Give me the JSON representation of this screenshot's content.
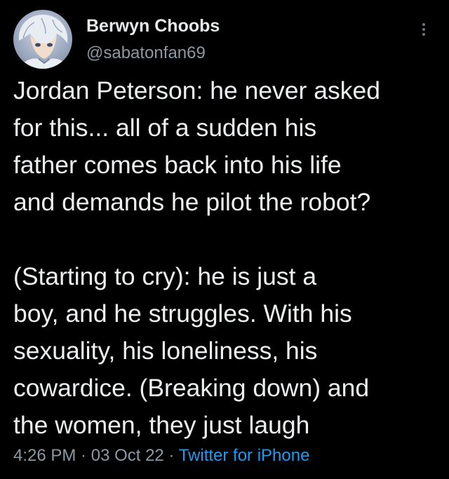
{
  "colors": {
    "background": "#000000",
    "primary_text": "#e7e9ea",
    "secondary_text": "#8b98a5",
    "link": "#1d9bf0"
  },
  "author": {
    "display_name": "Berwyn Choobs",
    "handle": "@sabatonfan69",
    "avatar_icon": "anime-character-avatar"
  },
  "menu": {
    "icon": "more-vertical-icon"
  },
  "tweet": {
    "lines": [
      "Jordan Peterson: he never asked",
      "for this... all of a sudden his",
      "father comes back into his life",
      "and demands he pilot the robot?",
      "",
      "(Starting to cry): he is just a",
      "boy, and he struggles. With his",
      "sexuality, his loneliness, his",
      "cowardice. (Breaking down) and",
      "the women, they just laugh"
    ]
  },
  "meta": {
    "time": "4:26 PM",
    "separator": " · ",
    "date": "03 Oct 22",
    "source": "Twitter for iPhone"
  }
}
